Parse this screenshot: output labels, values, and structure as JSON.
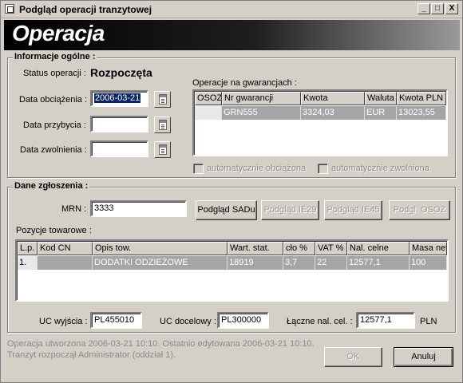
{
  "window": {
    "title": "Podgląd operacji tranzytowej",
    "controls": {
      "minimize": "_",
      "maximize": "□",
      "close": "X"
    }
  },
  "banner": {
    "title": "Operacja"
  },
  "general": {
    "label": "Informacje ogólne :",
    "status_label": "Status operacji :",
    "status_value": "Rozpoczęta",
    "data_obciazenia_label": "Data obciążenia :",
    "data_obciazenia_value": "2006-03-21",
    "data_przybycia_label": "Data przybycia :",
    "data_przybycia_value": "",
    "data_zwolnienia_label": "Data zwolnienia :",
    "data_zwolnienia_value": "",
    "guarantees_label": "Operacje na gwarancjach :",
    "guarantee_columns": [
      "OSOZ",
      "Nr gwarancji",
      "Kwota",
      "Waluta",
      "Kwota PLN"
    ],
    "guarantee_rows": [
      {
        "osoz": "",
        "nr": "GRN555",
        "kwota": "3324,03",
        "waluta": "EUR",
        "kwota_pln": "13023,55"
      }
    ],
    "auto_obciazona": "automatycznie obciążona",
    "auto_zwolniona": "automatycznie zwolniona"
  },
  "declaration": {
    "label": "Dane zgłoszenia :",
    "mrn_label": "MRN :",
    "mrn_value": "3333",
    "buttons": {
      "podglad_sadu": "Podgląd SADu",
      "podglad_ie29": "Podgląd IE29",
      "podglad_ie45": "Podgląd IE45",
      "podgl_osoz": "Podgl. OSOZ"
    },
    "items_label": "Pozycje towarowe :",
    "item_columns": [
      "L.p.",
      "Kod CN",
      "Opis tow.",
      "Wart. stat.",
      "cło %",
      "VAT %",
      "Nal. celne",
      "Masa nett"
    ],
    "item_rows": [
      {
        "lp": "1.",
        "kod_cn": "",
        "opis": "DODATKI ODZIEŻOWE",
        "wart": "18919",
        "clo": "3,7",
        "vat": "22",
        "nal": "12577,1",
        "masa": "100"
      }
    ],
    "uc_wyjscia_label": "UC wyjścia :",
    "uc_wyjscia_value": "PL455010",
    "uc_docelowy_label": "UC docelowy :",
    "uc_docelowy_value": "PL300000",
    "laczne_label": "Łączne nal. cel. :",
    "laczne_value": "12577,1",
    "currency": "PLN"
  },
  "footer": {
    "line1": "Operacja utworzona 2006-03-21 10:10. Ostatnio edytowana 2006-03-21 10:10.",
    "line2": "Tranzyt rozpoczął Administrator (oddział 1).",
    "ok": "OK",
    "cancel": "Anuluj"
  }
}
